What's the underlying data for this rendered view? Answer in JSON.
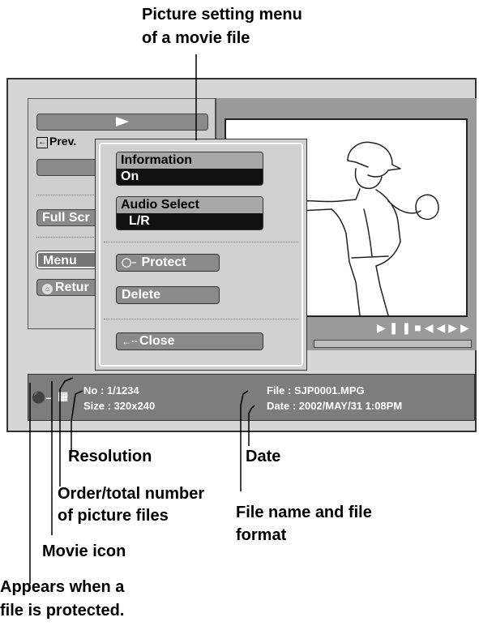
{
  "callouts": {
    "menu_title_line1": "Picture setting menu",
    "menu_title_line2": "of a movie file",
    "resolution": "Resolution",
    "date": "Date",
    "order_line1": "Order/total number",
    "order_line2": "of picture files",
    "filename_line1": "File name and file",
    "filename_line2": "format",
    "movie_icon": "Movie icon",
    "protect_line1": "Appears when a",
    "protect_line2": "file is protected."
  },
  "left_panel": {
    "prev_label": "Prev.",
    "fullscreen_label": "Full Scr",
    "menu_label": "Menu",
    "return_label": "Retur"
  },
  "menu": {
    "information_label": "Information",
    "information_value": "On",
    "audio_label": "Audio Select",
    "audio_value": "L/R",
    "protect_label": "Protect",
    "delete_label": "Delete",
    "close_label": "Close"
  },
  "status": {
    "no": "No  : 1/1234",
    "size": "Size : 320x240",
    "file": "File  : SJP0001.MPG",
    "date": "Date : 2002/MAY/31 1:08PM"
  },
  "icons": [
    "play-icon",
    "prev-arrow-icon",
    "home-icon",
    "key-icon",
    "film-icon",
    "pause-icon",
    "stop-icon",
    "rewind-icon",
    "fast-forward-icon",
    "close-arrow-icon"
  ]
}
